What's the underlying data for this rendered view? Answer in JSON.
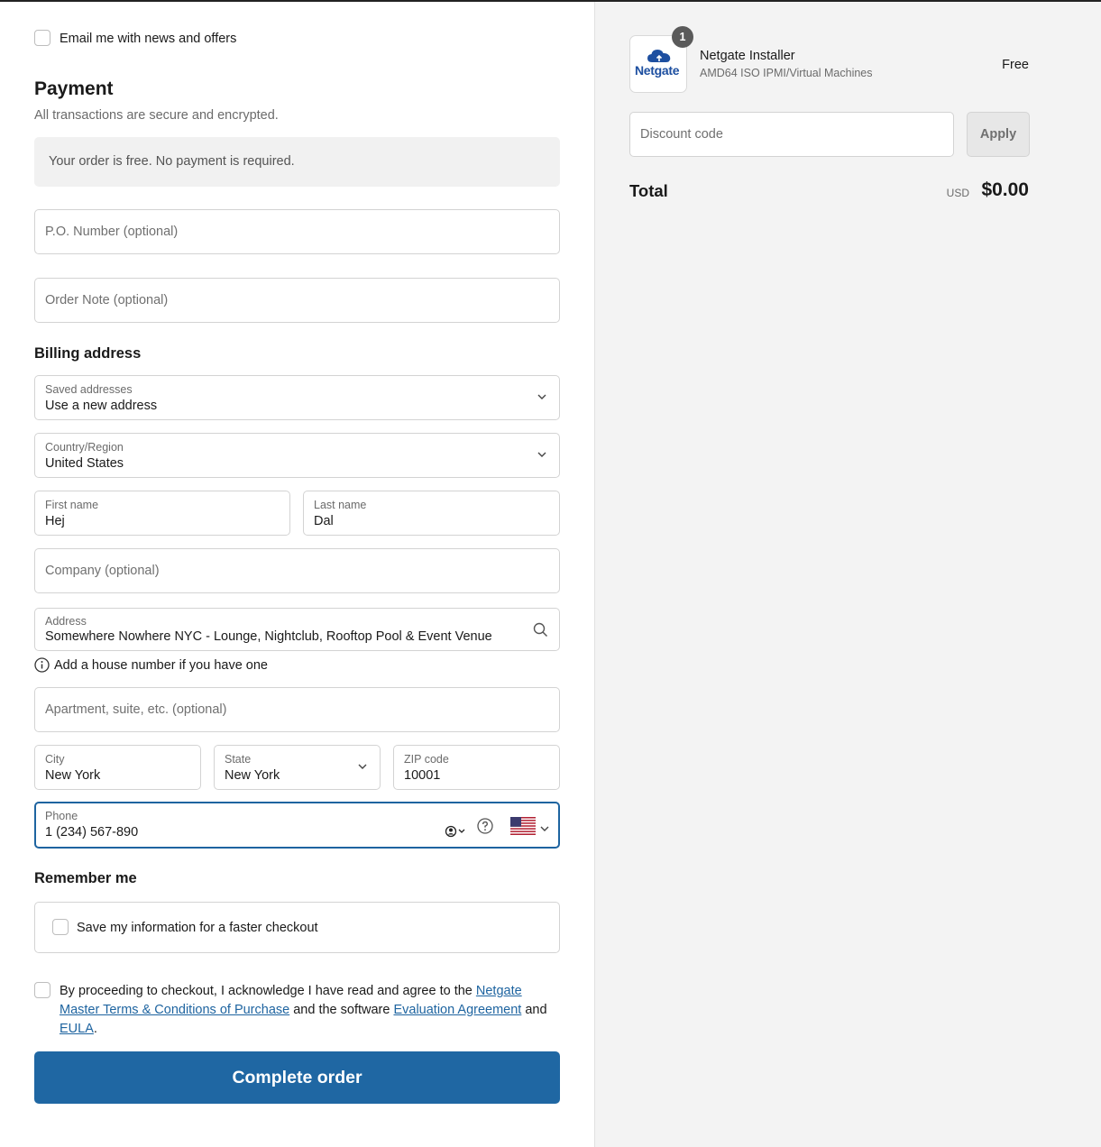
{
  "contact": {
    "email_news_label": "Email me with news and offers"
  },
  "payment": {
    "title": "Payment",
    "subtitle": "All transactions are secure and encrypted.",
    "free_notice": "Your order is free. No payment is required.",
    "po_number_placeholder": "P.O. Number (optional)",
    "order_note_placeholder": "Order Note (optional)"
  },
  "billing": {
    "title": "Billing address",
    "saved_addresses": {
      "label": "Saved addresses",
      "value": "Use a new address"
    },
    "country": {
      "label": "Country/Region",
      "value": "United States"
    },
    "first_name": {
      "label": "First name",
      "value": "Hej"
    },
    "last_name": {
      "label": "Last name",
      "value": "Dal"
    },
    "company_placeholder": "Company (optional)",
    "address": {
      "label": "Address",
      "value": "Somewhere Nowhere NYC - Lounge, Nightclub, Rooftop Pool & Event Venue"
    },
    "house_number_hint": "Add a house number if you have one",
    "apartment_placeholder": "Apartment, suite, etc. (optional)",
    "city": {
      "label": "City",
      "value": "New York"
    },
    "state": {
      "label": "State",
      "value": "New York"
    },
    "zip": {
      "label": "ZIP code",
      "value": "10001"
    },
    "phone": {
      "label": "Phone",
      "value": "1 (234) 567-890"
    }
  },
  "remember": {
    "title": "Remember me",
    "save_label": "Save my information for a faster checkout"
  },
  "terms": {
    "prefix": "By proceeding to checkout, I acknowledge I have read and agree to the ",
    "link_terms": "Netgate Master Terms & Conditions of Purchase",
    "middle": " and the software ",
    "link_eval": "Evaluation Agreement",
    "and": " and ",
    "link_eula": "EULA",
    "end": "."
  },
  "complete_button": "Complete order",
  "summary": {
    "item": {
      "quantity": "1",
      "logo_text": "Netgate",
      "name": "Netgate Installer",
      "variant": "AMD64 ISO IPMI/Virtual Machines",
      "price": "Free"
    },
    "discount_placeholder": "Discount code",
    "apply_label": "Apply",
    "total_label": "Total",
    "currency": "USD",
    "total_value": "$0.00"
  },
  "colors": {
    "primary": "#1f67a3",
    "link": "#1e64a0",
    "sidebar_bg": "#f3f3f3"
  },
  "icons": [
    "chevron-down-icon",
    "search-icon",
    "info-icon",
    "contact-icon",
    "help-icon",
    "us-flag-icon",
    "cloud-logo-icon"
  ]
}
